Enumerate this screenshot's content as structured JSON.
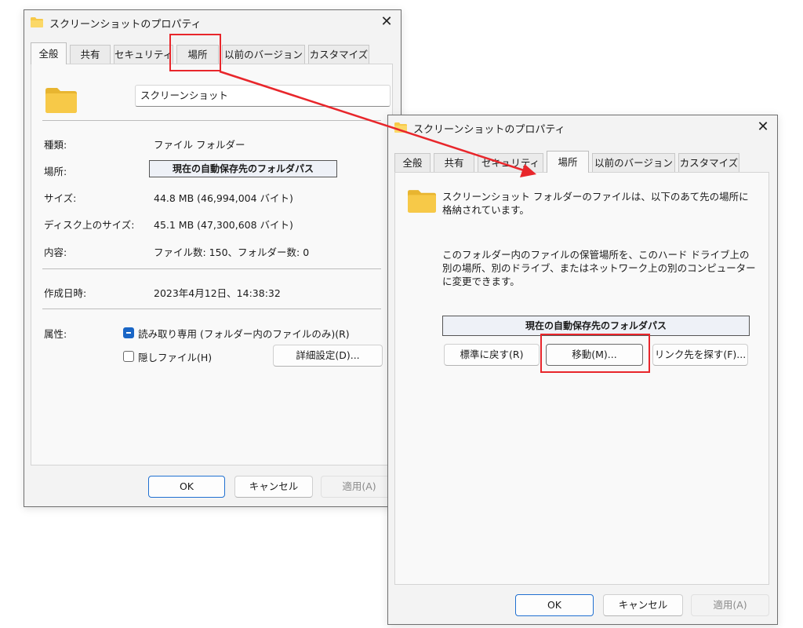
{
  "left_dialog": {
    "title": "スクリーンショットのプロパティ",
    "close_glyph": "✕",
    "tabs": [
      "全般",
      "共有",
      "セキュリティ",
      "場所",
      "以前のバージョン",
      "カスタマイズ"
    ],
    "active_tab": "全般",
    "name_value": "スクリーンショット",
    "rows": {
      "type_label": "種類:",
      "type_value": "ファイル フォルダー",
      "location_label": "場所:",
      "location_value": "現在の自動保存先のフォルダパス",
      "size_label": "サイズ:",
      "size_value": "44.8 MB (46,994,004 バイト)",
      "disk_size_label": "ディスク上のサイズ:",
      "disk_size_value": "45.1 MB (47,300,608 バイト)",
      "contents_label": "内容:",
      "contents_value": "ファイル数: 150、フォルダー数: 0",
      "created_label": "作成日時:",
      "created_value": "2023年4月12日、14:38:32",
      "attributes_label": "属性:",
      "readonly_label": "読み取り専用 (フォルダー内のファイルのみ)(R)",
      "readonly_checked": true,
      "hidden_label": "隠しファイル(H)",
      "hidden_checked": false,
      "advanced_button": "詳細設定(D)..."
    },
    "buttons": {
      "ok": "OK",
      "cancel": "キャンセル",
      "apply": "適用(A)"
    }
  },
  "right_dialog": {
    "title": "スクリーンショットのプロパティ",
    "close_glyph": "✕",
    "tabs": [
      "全般",
      "共有",
      "セキュリティ",
      "場所",
      "以前のバージョン",
      "カスタマイズ"
    ],
    "active_tab": "場所",
    "info_text": "スクリーンショット フォルダーのファイルは、以下のあて先の場所に格納されています。",
    "move_text": "このフォルダー内のファイルの保管場所を、このハード ドライブ上の別の場所、別のドライブ、またはネットワーク上の別のコンピューターに変更できます。",
    "path_value": "現在の自動保存先のフォルダパス",
    "restore_button": "標準に戻す(R)",
    "move_button": "移動(M)...",
    "find_target_button": "リンク先を探す(F)...",
    "buttons": {
      "ok": "OK",
      "cancel": "キャンセル",
      "apply": "適用(A)"
    }
  },
  "colors": {
    "highlight_red": "#e8262b",
    "checkbox_blue": "#1a66c6",
    "folder_yellow": "#f7c948"
  },
  "icons": [
    "folder-icon",
    "close-icon",
    "checkbox-checked-icon",
    "checkbox-unchecked-icon",
    "arrow-annotation"
  ]
}
